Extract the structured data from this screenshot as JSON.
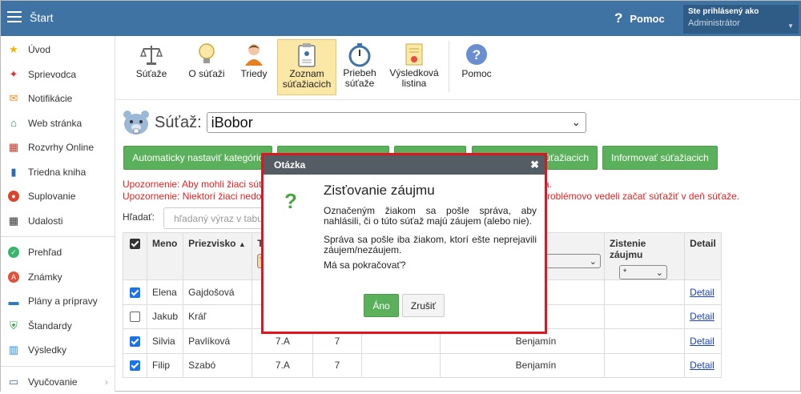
{
  "topbar": {
    "title": "Štart",
    "help": "Pomoc",
    "user_line1": "Ste prihlásený ako",
    "user_line2": "Administrátor"
  },
  "sidebar": {
    "items": [
      {
        "label": "Úvod",
        "icon": "star-icon"
      },
      {
        "label": "Sprievodca",
        "icon": "magic-wand-icon"
      },
      {
        "label": "Notifikácie",
        "icon": "envelope-icon"
      },
      {
        "label": "Web stránka",
        "icon": "house-icon"
      },
      {
        "label": "Rozvrhy Online",
        "icon": "calendar-icon"
      },
      {
        "label": "Triedna kniha",
        "icon": "book-icon"
      },
      {
        "label": "Suplovanie",
        "icon": "person-icon"
      },
      {
        "label": "Udalosti",
        "icon": "calendar-dark-icon"
      },
      {
        "label": "Prehľad",
        "icon": "check-circle-icon"
      },
      {
        "label": "Známky",
        "icon": "grades-icon"
      },
      {
        "label": "Plány a prípravy",
        "icon": "briefcase-icon"
      },
      {
        "label": "Štandardy",
        "icon": "shield-icon"
      },
      {
        "label": "Výsledky",
        "icon": "bar-chart-icon"
      },
      {
        "label": "Vyučovanie",
        "icon": "monitor-icon"
      }
    ]
  },
  "toolbar": {
    "items": [
      {
        "label": "Súťaže"
      },
      {
        "label": "O súťaži"
      },
      {
        "label": "Triedy"
      },
      {
        "label": "Zoznam súťažiacich"
      },
      {
        "label": "Priebeh súťaže"
      },
      {
        "label": "Výsledková listina"
      },
      {
        "label": "Pomoc"
      }
    ]
  },
  "contest": {
    "label": "Súťaž:",
    "selected": "iBobor"
  },
  "buttons": {
    "auto_category": "Automaticky nastaviť kategóric",
    "hidden_right": "súťažiacich",
    "inform": "Informovať súťažiacich"
  },
  "warnings": {
    "w1": "Upozornenie: Aby mohli žiaci súť",
    "w1_tail": "a.",
    "w2": "Upozornenie: Niektorí žiaci nedo",
    "w2_tail": "roblémovo vedeli začať súťažiť v deň súťaže."
  },
  "search": {
    "label": "Hľadať:",
    "placeholder": "hľadaný výraz v tabu"
  },
  "table": {
    "headers": {
      "meno": "Meno",
      "priezvisko": "Priezvisko",
      "trieda": "Tr",
      "zistenie": "Zistenie záujmu",
      "detail": "Detail"
    },
    "trieda_filter": "7",
    "zistenie_filter": "*",
    "rows": [
      {
        "checked": true,
        "meno": "Elena",
        "priezvisko": "Gajdošová",
        "trieda": "",
        "rocnik": "",
        "kategoria": "",
        "detail": "Detail"
      },
      {
        "checked": false,
        "meno": "Jakub",
        "priezvisko": "Kráľ",
        "trieda": "",
        "rocnik": "",
        "kategoria": "",
        "detail": "Detail"
      },
      {
        "checked": true,
        "meno": "Silvia",
        "priezvisko": "Pavlíková",
        "trieda": "7.A",
        "rocnik": "7",
        "kategoria": "Benjamín",
        "detail": "Detail"
      },
      {
        "checked": true,
        "meno": "Filip",
        "priezvisko": "Szabó",
        "trieda": "7.A",
        "rocnik": "7",
        "kategoria": "Benjamín",
        "detail": "Detail"
      }
    ]
  },
  "modal": {
    "header": "Otázka",
    "title": "Zisťovanie záujmu",
    "p1": "Označeným žiakom sa pošle správa, aby nahlásili, či o túto súťaž majú záujem (alebo nie).",
    "p2": "Správa sa pošle iba žiakom, ktorí ešte neprejavili záujem/nezáujem.",
    "p3": "Má sa pokračovať?",
    "yes": "Áno",
    "cancel": "Zrušiť"
  }
}
